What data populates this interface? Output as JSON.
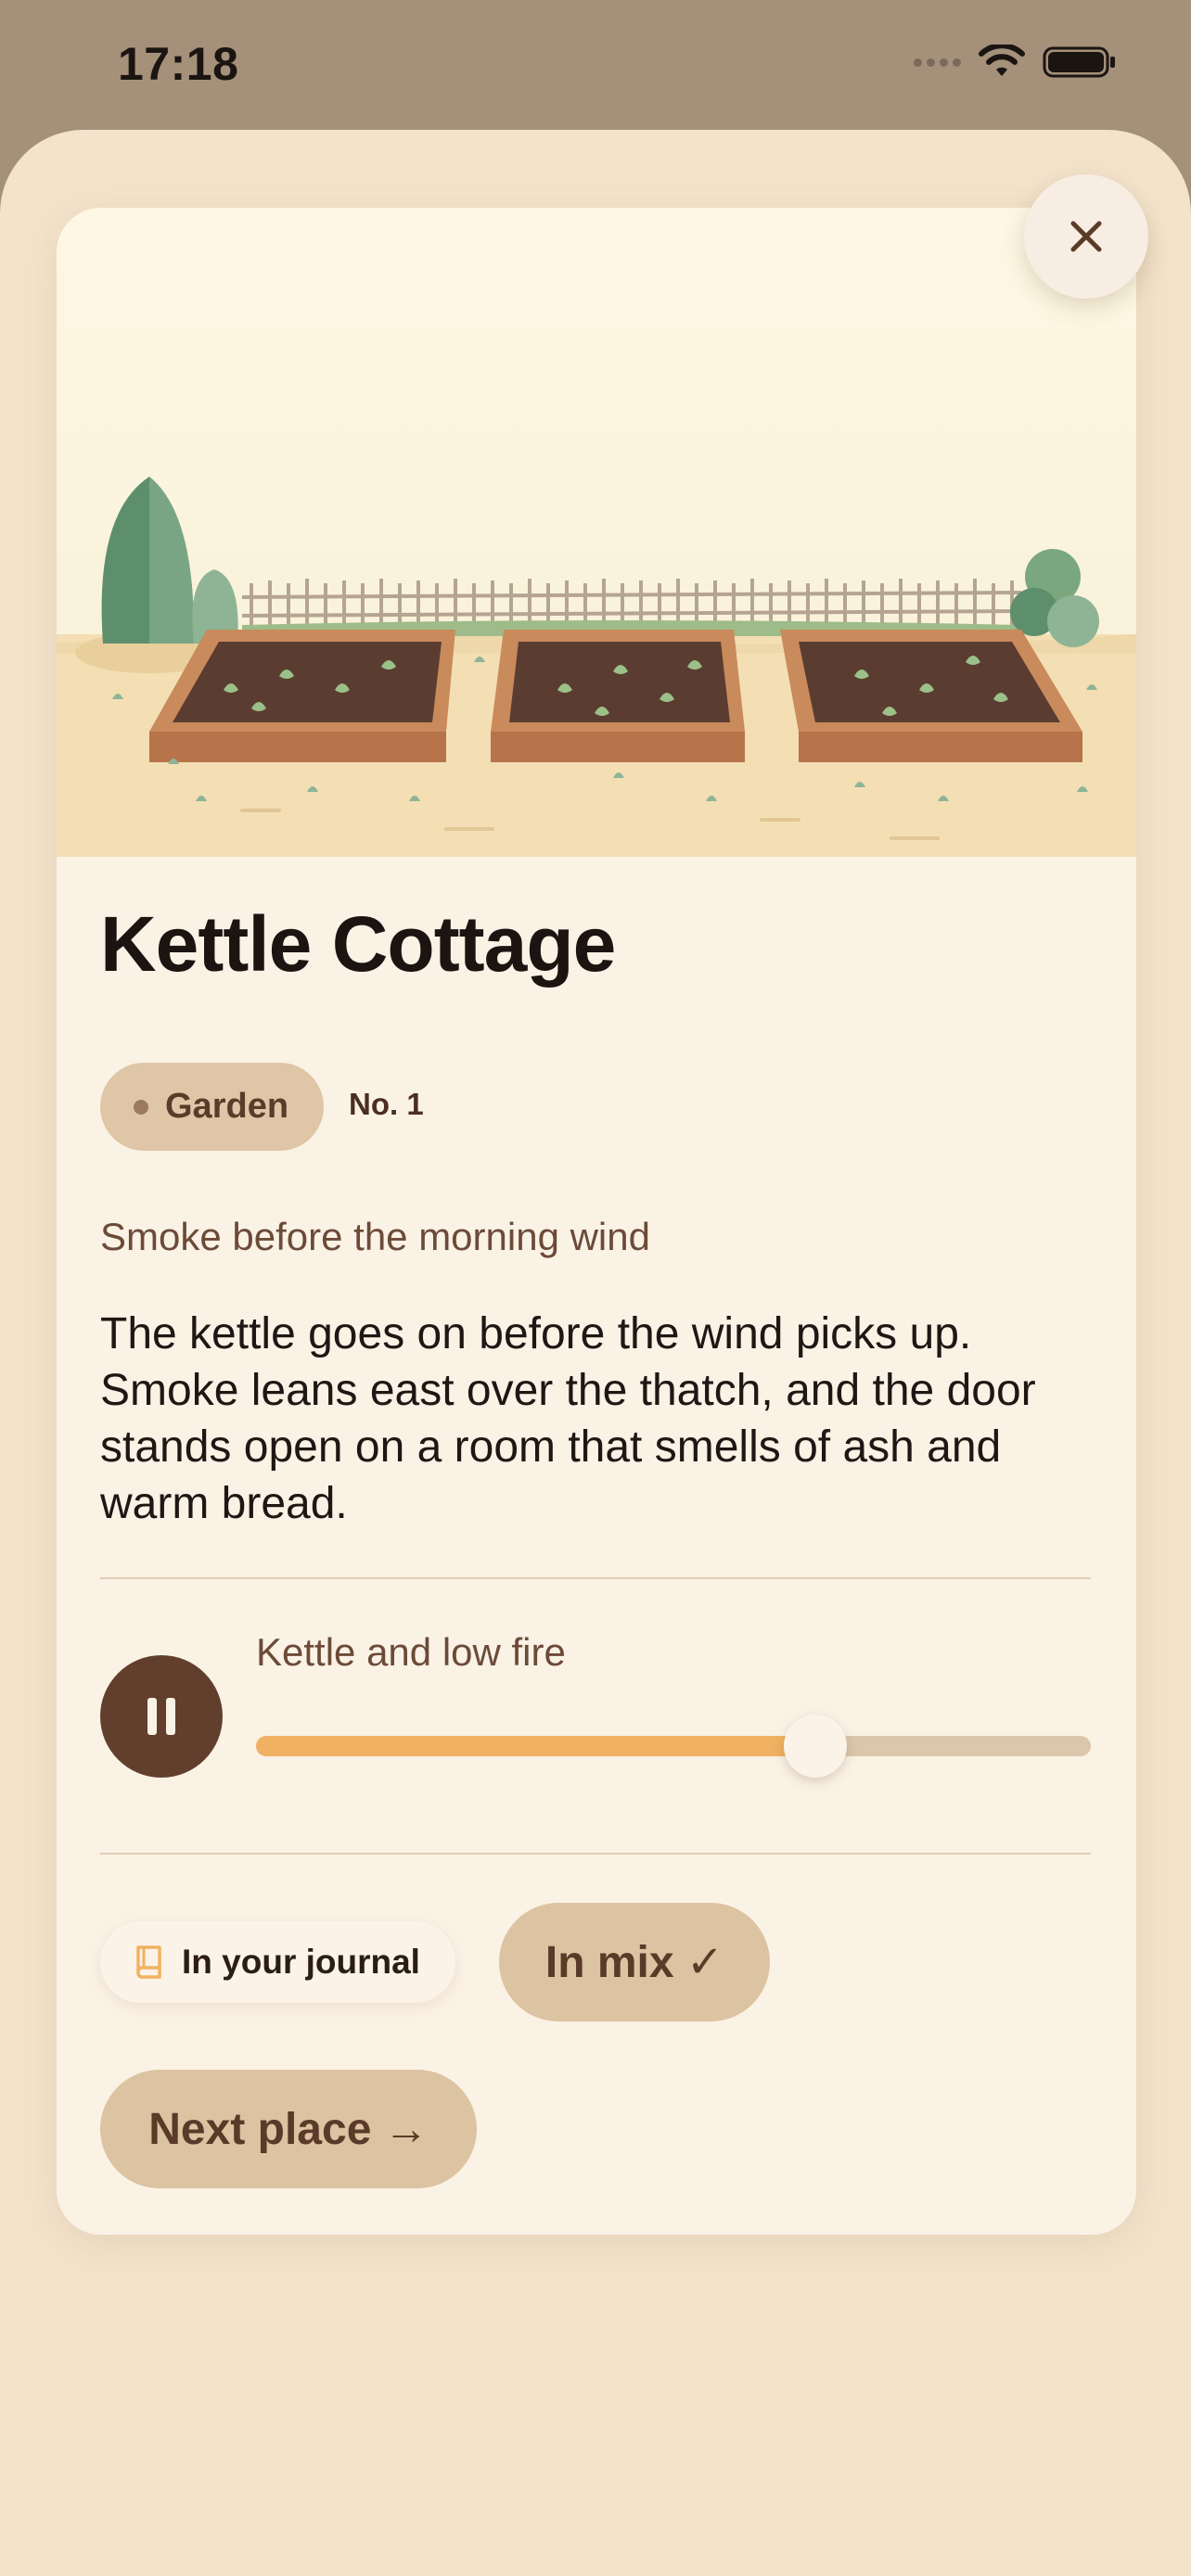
{
  "status_bar": {
    "time": "17:18"
  },
  "place": {
    "title": "Kettle Cottage",
    "category": "Garden",
    "number": "No. 1",
    "subtitle": "Smoke before the morning wind",
    "description": "The kettle goes on before the wind picks up. Smoke leans east over the thatch, and the door stands open on a room that smells of ash and warm bread."
  },
  "player": {
    "track_title": "Kettle and low fire",
    "state": "playing",
    "progress": 0.67
  },
  "actions": {
    "journal_label": "In your journal",
    "mix_label": "In mix ✓",
    "next_label": "Next place →"
  },
  "icons": {
    "close": "close-icon",
    "pause": "pause-icon",
    "journal": "book-icon",
    "wifi": "wifi-icon",
    "battery": "battery-icon",
    "signal": "signal-icon"
  },
  "colors": {
    "accent": "#f0b262",
    "brown": "#623f2c",
    "badge": "#dec6a6",
    "button": "#dcc3a1"
  }
}
